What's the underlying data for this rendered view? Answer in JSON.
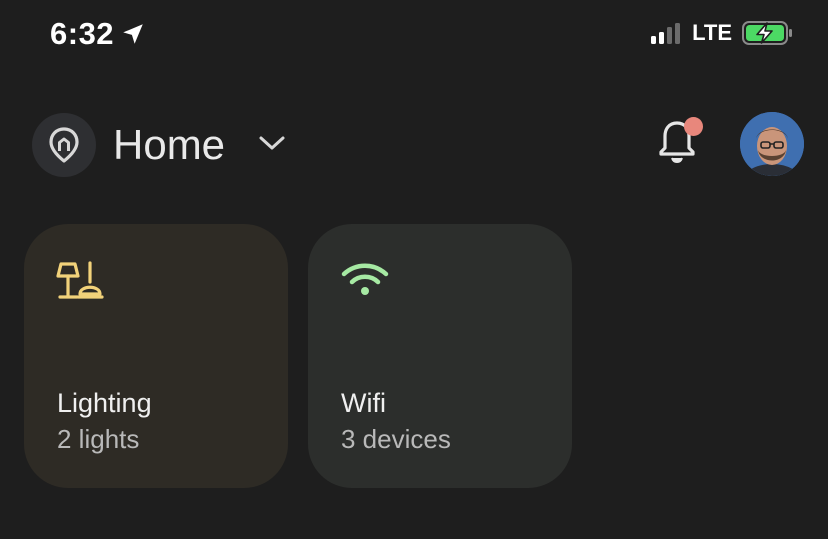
{
  "status_bar": {
    "time": "6:32",
    "network": "LTE",
    "icons": [
      "location-arrow-icon",
      "signal-icon",
      "battery-charging-icon"
    ]
  },
  "header": {
    "home_name": "Home",
    "icons": [
      "home-pin-icon",
      "chevron-down-icon",
      "bell-icon"
    ],
    "notification_badge_color": "#e8877c"
  },
  "cards": [
    {
      "title": "Lighting",
      "subtitle": "2 lights",
      "icon": "lamp-icon",
      "accent": "#f2d27a"
    },
    {
      "title": "Wifi",
      "subtitle": "3 devices",
      "icon": "wifi-icon",
      "accent": "#a6e9a3"
    }
  ],
  "colors": {
    "background": "#1e1e1e",
    "lighting_card": "#2e2b25",
    "wifi_card": "#2c2e2c",
    "battery_fill": "#4cd964"
  }
}
